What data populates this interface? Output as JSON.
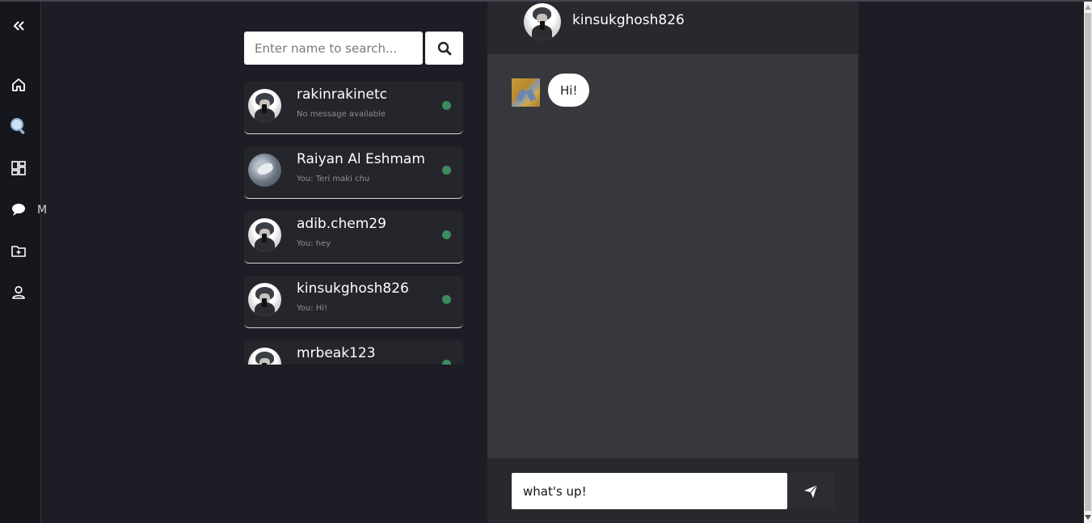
{
  "sidebar": {
    "collapse_icon": "double-chevron-left-icon",
    "items": [
      {
        "icon": "home-icon"
      },
      {
        "icon": "search-icon"
      },
      {
        "icon": "dashboard-icon"
      },
      {
        "icon": "chat-icon"
      },
      {
        "icon": "add-folder-icon"
      },
      {
        "icon": "user-icon"
      }
    ],
    "peek_label": "M"
  },
  "search": {
    "placeholder": "Enter name to search...",
    "button_icon": "search-icon"
  },
  "conversations": [
    {
      "name": "rakinrakinetc",
      "last_message": "No message available",
      "online": true,
      "avatar": "default"
    },
    {
      "name": "Raiyan Al Eshmam",
      "last_message": "You: Teri maki chu",
      "online": true,
      "avatar": "alt"
    },
    {
      "name": "adib.chem29",
      "last_message": "You: hey",
      "online": true,
      "avatar": "default"
    },
    {
      "name": "kinsukghosh826",
      "last_message": "You: Hi!",
      "online": true,
      "avatar": "default"
    },
    {
      "name": "mrbeak123",
      "last_message": "",
      "online": true,
      "avatar": "default"
    }
  ],
  "chat": {
    "header_name": "kinsukghosh826",
    "messages": [
      {
        "text": "Hi!"
      }
    ],
    "input_value": "what's up!",
    "send_icon": "send-icon"
  },
  "colors": {
    "background": "#1c1d25",
    "sidebar": "#16171d",
    "card": "#25262b",
    "chat_bg": "#37383e",
    "header_bg": "#28292e",
    "online_dot": "#3d8b5e"
  }
}
